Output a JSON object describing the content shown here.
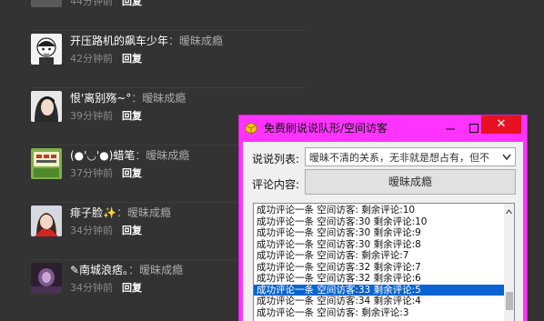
{
  "feed": {
    "top_partial": {
      "time": "44分钟前",
      "reply": "回复"
    },
    "comments": [
      {
        "name": "开压路机的飙车少年",
        "text": "：暧昧成瘾",
        "time": "42分钟前",
        "reply": "回复",
        "avatar": "avatar-face"
      },
      {
        "name": "恨'离别殇~°",
        "text": "：暧昧成瘾",
        "time": "39分钟前",
        "reply": "回复",
        "avatar": "avatar-girl"
      },
      {
        "name": "(●'◡'●)蜡笔",
        "text": "：暧昧成瘾",
        "time": "37分钟前",
        "reply": "回复",
        "avatar": "avatar-sign"
      },
      {
        "name": "痱子脸✨",
        "text": "：暧昧成瘾",
        "time": "34分钟前",
        "reply": "回复",
        "avatar": "avatar-red"
      },
      {
        "name": "✎南城浪痞。",
        "text": "：暧昧成瘾",
        "time": "34分钟前",
        "reply": "回复",
        "avatar": "avatar-purple"
      }
    ]
  },
  "window": {
    "title": "免费刷说说队形/空间访客",
    "min": "—",
    "max": "□",
    "close": "✕",
    "shuoshuo_label": "说说列表:",
    "shuoshuo_value": "暧昧不清的关系，无非就是想占有，但不",
    "comment_label": "评论内容:",
    "comment_value": "暧昧成瘾",
    "log_lines": [
      "成功评论一条 空间访客: 剩余评论:10",
      "成功评论一条 空间访客:30 剩余评论:10",
      "成功评论一条 空间访客:30 剩余评论:9",
      "成功评论一条 空间访客:30 剩余评论:8",
      "成功评论一条 空间访客: 剩余评论:7",
      "成功评论一条 空间访客:32 剩余评论:7",
      "成功评论一条 空间访客:32 剩余评论:6",
      "成功评论一条 空间访客:33 剩余评论:5",
      "成功评论一条 空间访客:34 剩余评论:4",
      "成功评论一条 空间访客: 剩余评论:3"
    ],
    "selected_line_index": 7
  }
}
